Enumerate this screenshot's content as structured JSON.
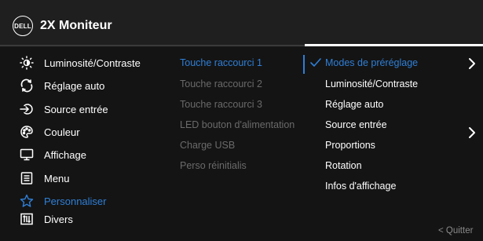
{
  "header": {
    "logo_text": "DELL",
    "title": "2X Moniteur"
  },
  "menu": [
    {
      "label": "Luminosité/Contraste",
      "icon": "brightness-icon",
      "selected": false
    },
    {
      "label": "Réglage auto",
      "icon": "auto-adjust-icon",
      "selected": false
    },
    {
      "label": "Source entrée",
      "icon": "input-source-icon",
      "selected": false
    },
    {
      "label": "Couleur",
      "icon": "color-palette-icon",
      "selected": false
    },
    {
      "label": "Affichage",
      "icon": "display-icon",
      "selected": false
    },
    {
      "label": "Menu",
      "icon": "menu-icon",
      "selected": false
    },
    {
      "label": "Personnaliser",
      "icon": "star-icon",
      "selected": true
    },
    {
      "label": "Divers",
      "icon": "others-icon",
      "selected": false
    }
  ],
  "submenu": [
    {
      "label": "Touche raccourci 1",
      "active": true
    },
    {
      "label": "Touche raccourci 2",
      "active": false
    },
    {
      "label": "Touche raccourci 3",
      "active": false
    },
    {
      "label": "LED bouton d'alimentation",
      "active": false
    },
    {
      "label": "Charge USB",
      "active": false
    },
    {
      "label": "Perso réinitialis",
      "active": false
    }
  ],
  "options": [
    {
      "label": "Modes de préréglage",
      "checked": true
    },
    {
      "label": "Luminosité/Contraste",
      "checked": false
    },
    {
      "label": "Réglage auto",
      "checked": false
    },
    {
      "label": "Source entrée",
      "checked": false
    },
    {
      "label": "Proportions",
      "checked": false
    },
    {
      "label": "Rotation",
      "checked": false
    },
    {
      "label": "Infos d'affichage",
      "checked": false
    }
  ],
  "footer": {
    "quit_label": "< Quitter"
  },
  "colors": {
    "accent": "#2f7fd7",
    "disabled": "#6a6a6a",
    "background": "#141414"
  }
}
